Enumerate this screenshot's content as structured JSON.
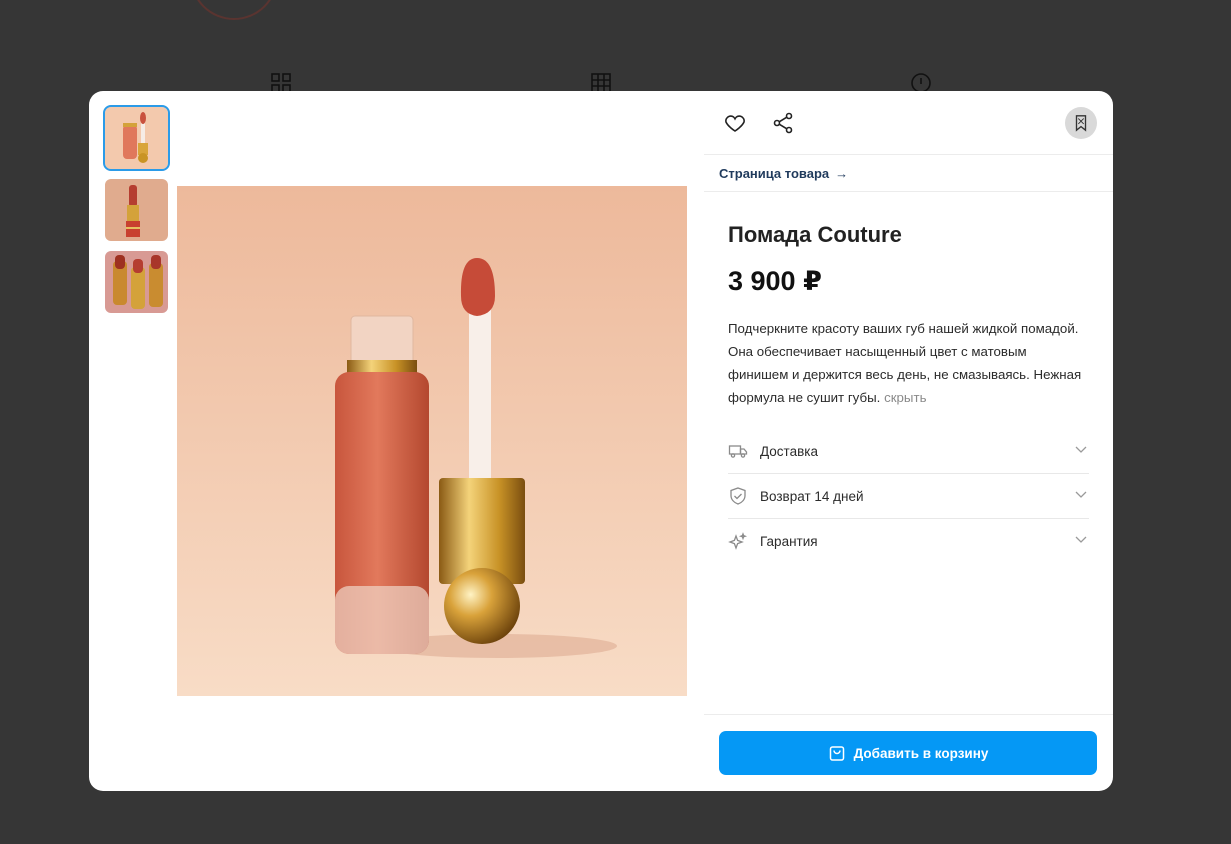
{
  "product": {
    "title": "Помада Couture",
    "price": "3 900 ₽",
    "description": "Подчеркните красоту ваших губ нашей жидкой помадой. Она обеспечивает насыщенный цвет с матовым финишем и держится весь день, не смазываясь. Нежная формула не сушит губы.",
    "description_toggle": "скрыть"
  },
  "nav": {
    "page_link_label": "Страница товара",
    "page_link_arrow": "→"
  },
  "accordion": [
    {
      "label": "Доставка",
      "icon": "truck-icon"
    },
    {
      "label": "Возврат 14 дней",
      "icon": "shield-check-icon"
    },
    {
      "label": "Гарантия",
      "icon": "sparkle-icon"
    }
  ],
  "cart": {
    "label": "Добавить в корзину",
    "icon": "shopping-bag-icon"
  },
  "gallery": {
    "active_index": 0,
    "thumbnails": [
      "liquid-lipstick",
      "lipstick-tube",
      "lipstick-set"
    ]
  },
  "colors": {
    "accent": "#0598f5",
    "link": "#1f3a5c",
    "backdrop": "#363636"
  }
}
